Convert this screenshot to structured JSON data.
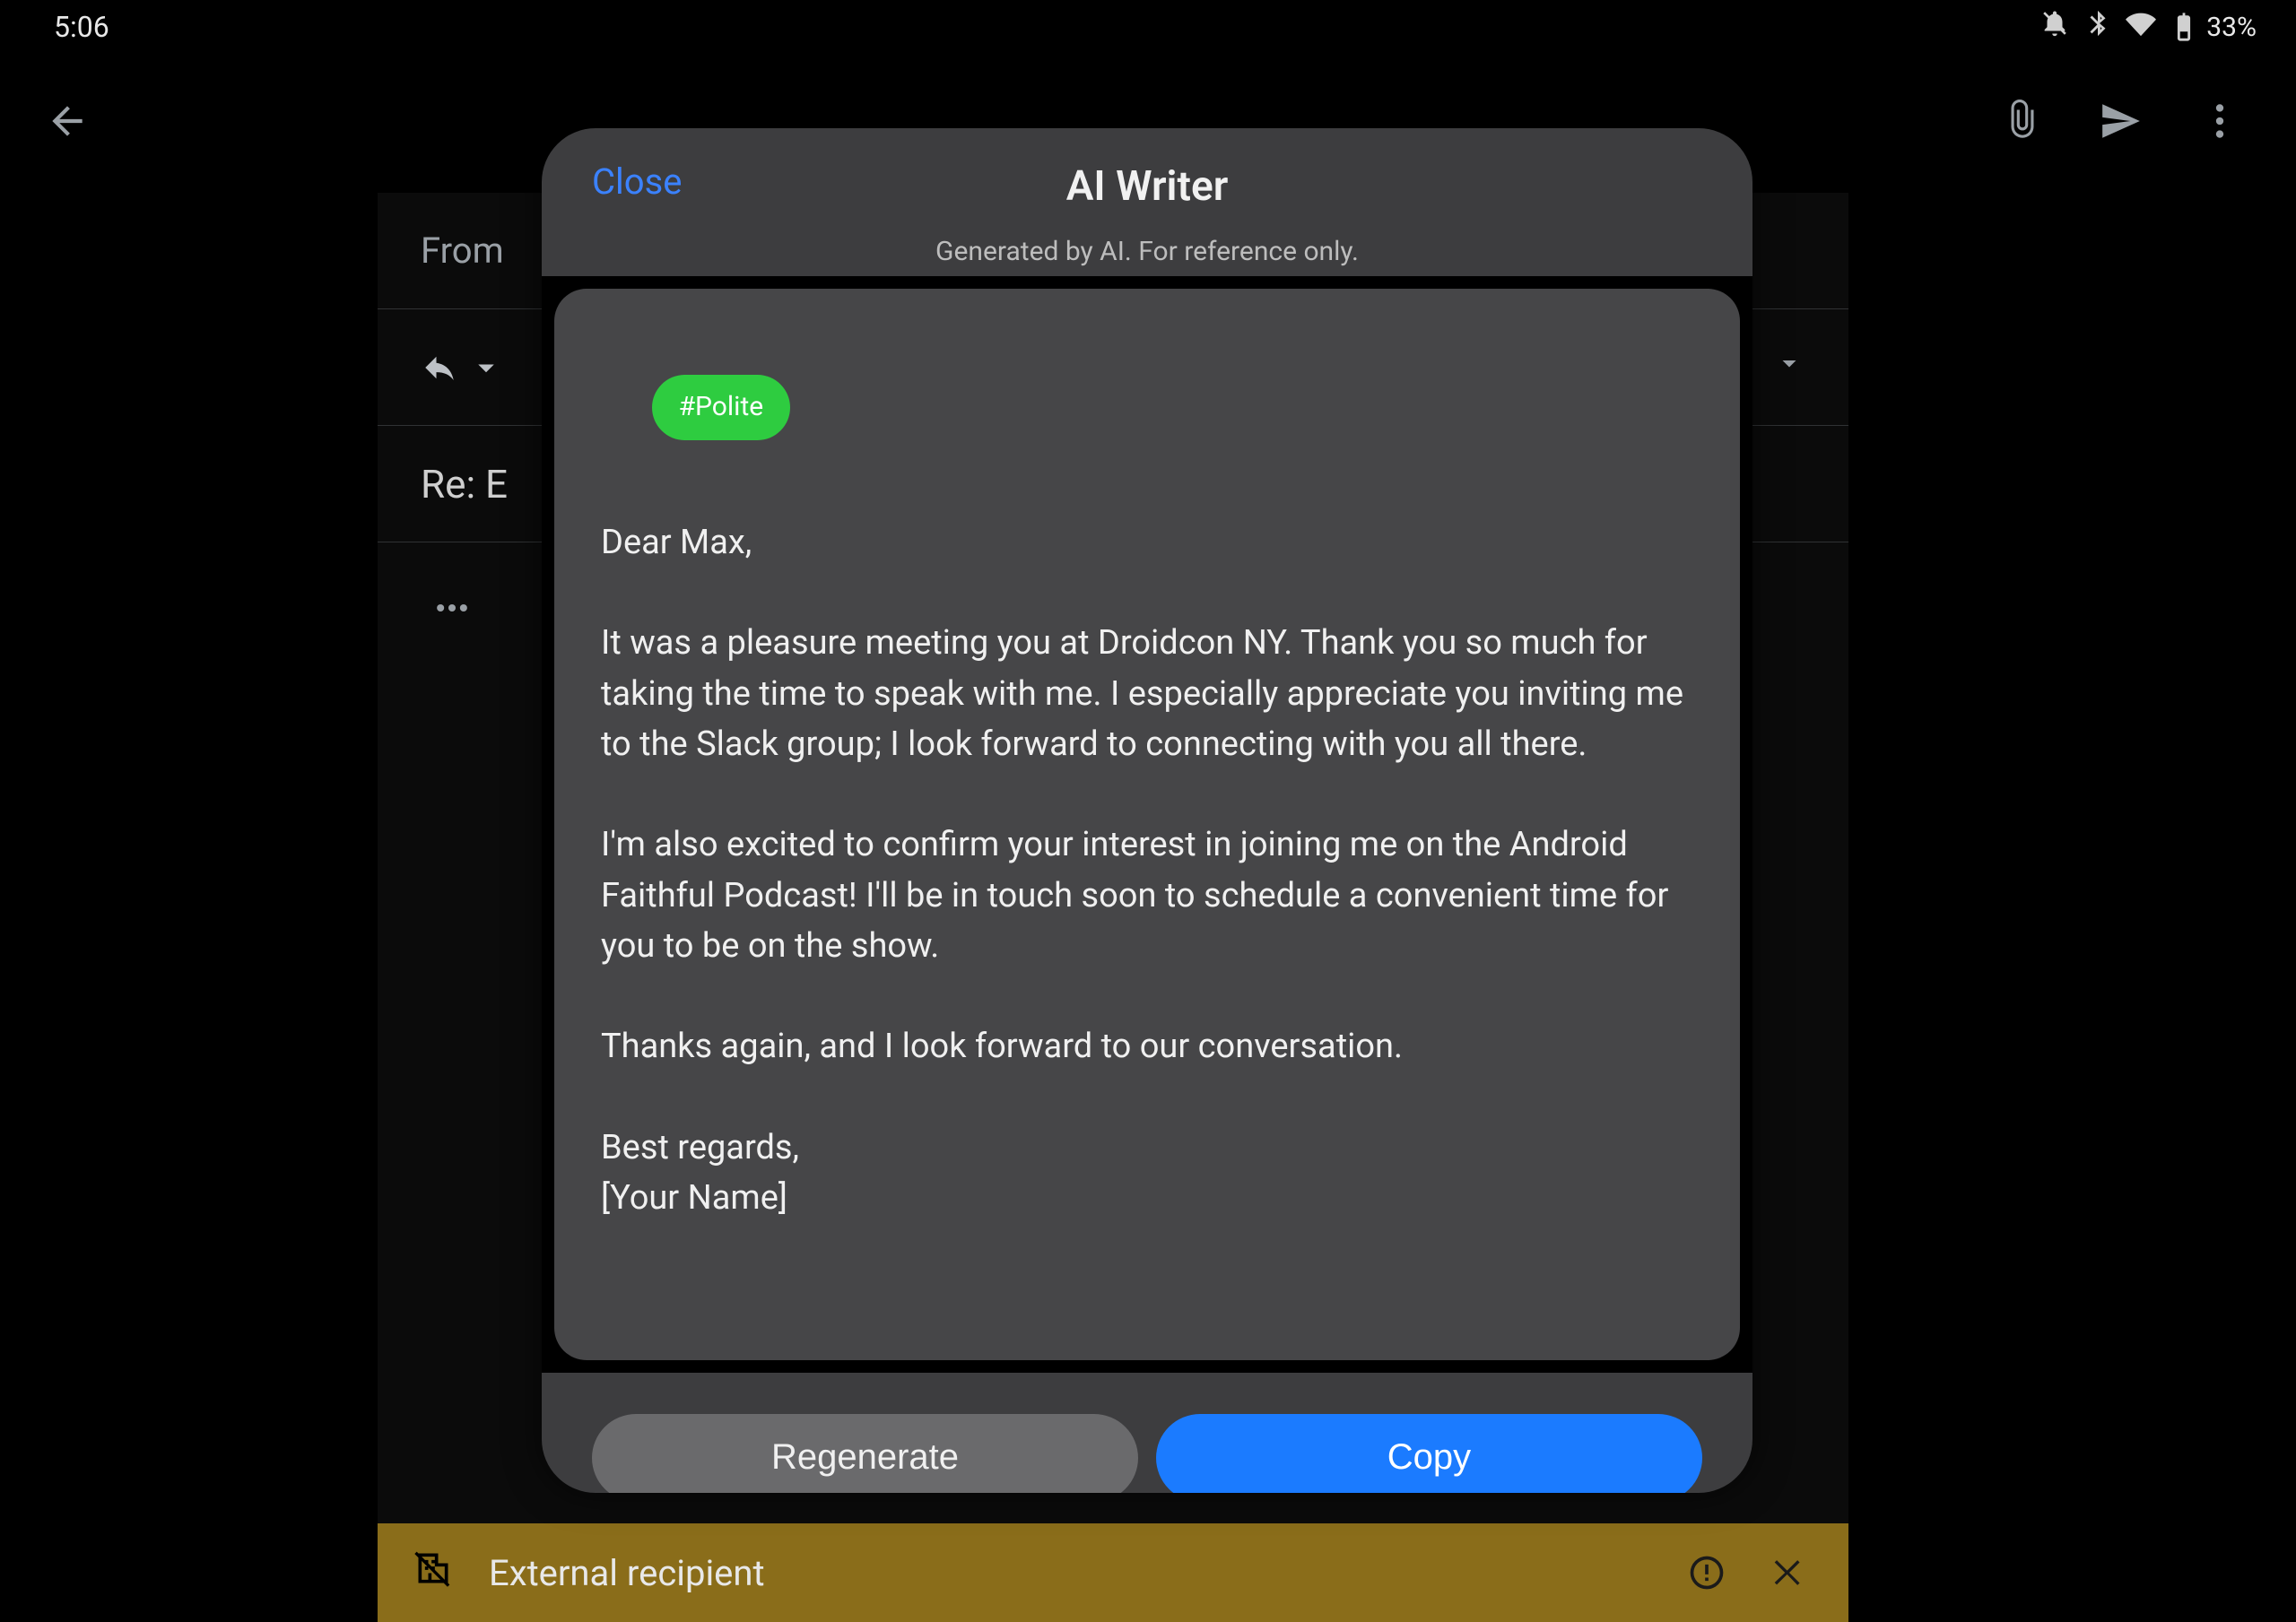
{
  "status_bar": {
    "time": "5:06",
    "battery_pct": "33%"
  },
  "toolbar": {},
  "compose": {
    "from_label": "From",
    "subject_prefix": "Re: E"
  },
  "ext_banner": {
    "label": "External recipient"
  },
  "modal": {
    "close_label": "Close",
    "title": "AI Writer",
    "subtitle": "Generated by AI. For reference only.",
    "tone_tag": "#Polite",
    "body": "Dear Max,\n\nIt was a pleasure meeting you at Droidcon NY. Thank you so much for taking the time to speak with me. I especially appreciate you inviting me to the Slack group; I look forward to connecting with you all there.\n\nI'm also excited to confirm your interest in joining me on the Android Faithful Podcast! I'll be in touch soon to schedule a convenient time for you to be on the show.\n\nThanks again, and I look forward to our conversation.\n\nBest regards,\n[Your Name]",
    "regenerate_label": "Regenerate",
    "copy_label": "Copy"
  }
}
